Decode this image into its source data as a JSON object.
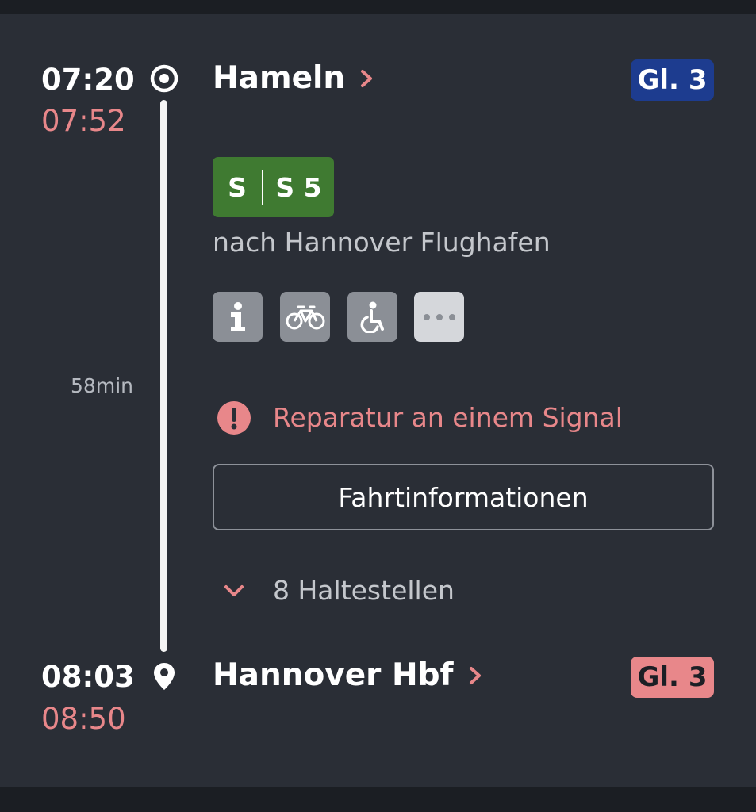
{
  "journey": {
    "departure": {
      "planned_time": "07:20",
      "actual_time": "07:52",
      "station": "Hameln",
      "platform": "Gl. 3",
      "icon": "origin-circle-icon"
    },
    "arrival": {
      "planned_time": "08:03",
      "actual_time": "08:50",
      "station": "Hannover Hbf",
      "platform": "Gl. 3",
      "icon": "location-pin-icon"
    },
    "duration": "58min",
    "line": {
      "product": "S",
      "name": "S 5",
      "color": "#3f7a31"
    },
    "direction": "nach Hannover Flughafen",
    "amenities": [
      {
        "icon": "info-icon"
      },
      {
        "icon": "bicycle-icon"
      },
      {
        "icon": "wheelchair-icon"
      },
      {
        "icon": "more-dots-icon"
      }
    ],
    "warning": {
      "text": "Reparatur an einem Signal",
      "icon": "exclamation-circle-icon"
    },
    "info_button": "Fahrtinformationen",
    "stops_toggle": "8 Haltestellen"
  },
  "colors": {
    "background": "#2a2e36",
    "delay": "#e8878a",
    "platform_normal": "#1d3c8f",
    "platform_changed": "#e8878a",
    "amenity_bg": "#8b8f96"
  }
}
